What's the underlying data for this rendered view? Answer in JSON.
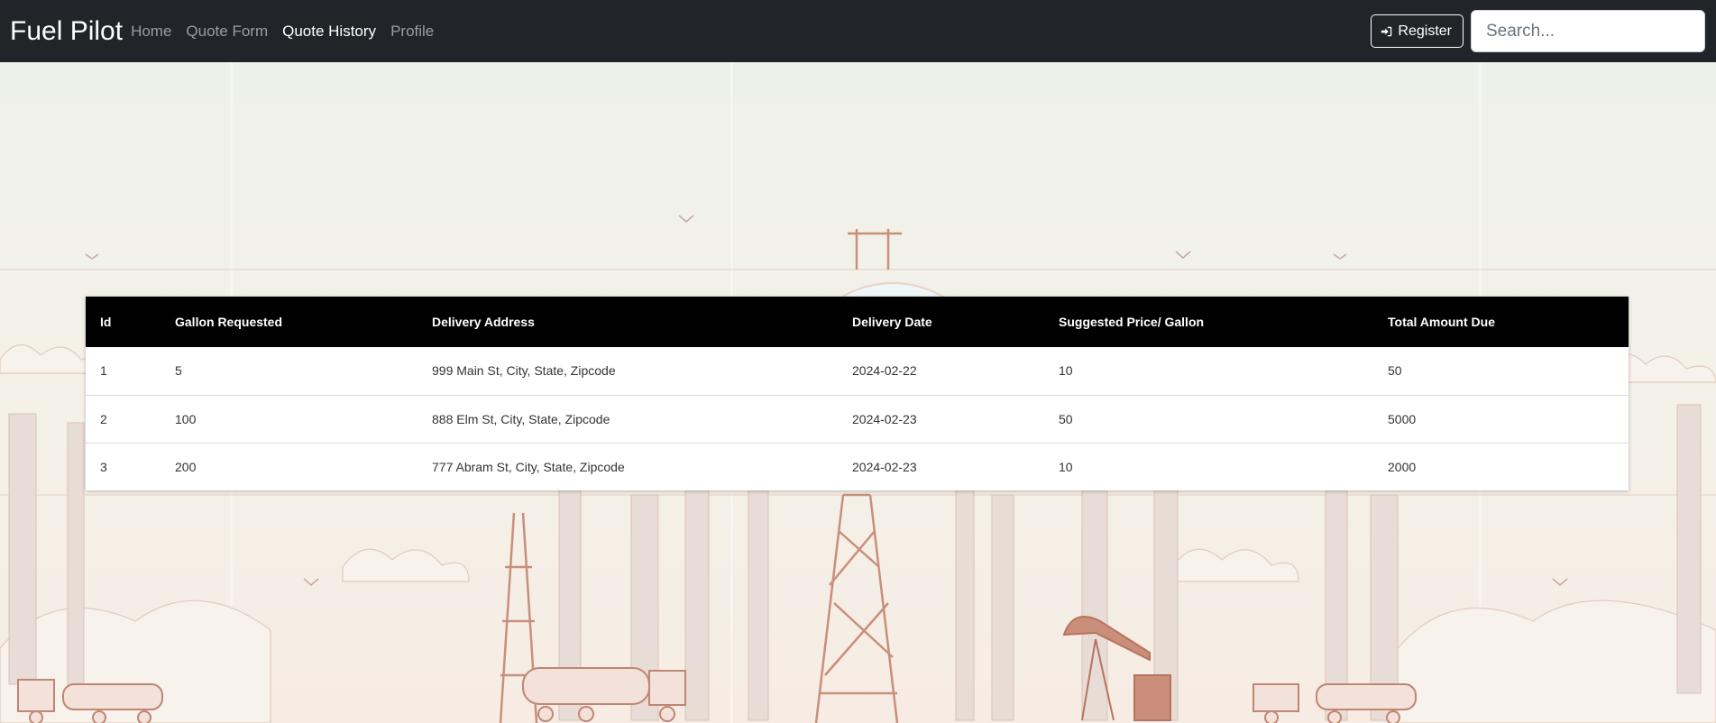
{
  "navbar": {
    "brand": "Fuel Pilot",
    "links": [
      {
        "label": "Home",
        "active": false
      },
      {
        "label": "Quote Form",
        "active": false
      },
      {
        "label": "Quote History",
        "active": true
      },
      {
        "label": "Profile",
        "active": false
      }
    ],
    "register_label": "Register",
    "register_icon": "sign-in-icon",
    "search_placeholder": "Search..."
  },
  "table": {
    "headers": [
      "Id",
      "Gallon Requested",
      "Delivery Address",
      "Delivery Date",
      "Suggested Price/ Gallon",
      "Total Amount Due"
    ],
    "rows": [
      [
        "1",
        "5",
        "999 Main St, City, State, Zipcode",
        "2024-02-22",
        "10",
        "50"
      ],
      [
        "2",
        "100",
        "888 Elm St, City, State, Zipcode",
        "2024-02-23",
        "50",
        "5000"
      ],
      [
        "3",
        "200",
        "777 Abram St, City, State, Zipcode",
        "2024-02-23",
        "10",
        "2000"
      ]
    ]
  },
  "colors": {
    "navbar_bg": "#212529",
    "table_header_bg": "#000000",
    "illustration_accent": "#c98f7a"
  }
}
